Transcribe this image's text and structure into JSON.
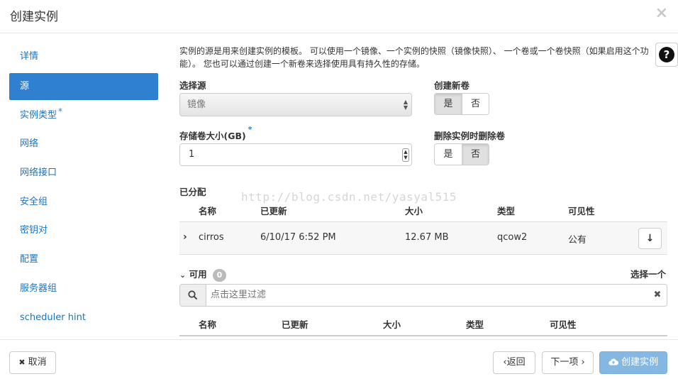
{
  "dialog": {
    "title": "创建实例",
    "close_icon": "×"
  },
  "sidebar": {
    "items": [
      {
        "label": "详情",
        "required": false
      },
      {
        "label": "源",
        "required": false
      },
      {
        "label": "实例类型",
        "required": true
      },
      {
        "label": "网络",
        "required": false
      },
      {
        "label": "网络接口",
        "required": false
      },
      {
        "label": "安全组",
        "required": false
      },
      {
        "label": "密钥对",
        "required": false
      },
      {
        "label": "配置",
        "required": false
      },
      {
        "label": "服务器组",
        "required": false
      },
      {
        "label": "scheduler hint",
        "required": false
      }
    ],
    "active_index": 1,
    "required_mark": "*"
  },
  "help": {
    "icon": "?"
  },
  "source": {
    "description": "实例的源是用来创建实例的模板。 可以使用一个镜像、一个实例的快照（镜像快照）、 一个卷或一个卷快照（如果启用这个功能）。 您也可以通过创建一个新卷来选择使用具有持久性的存储。",
    "select_source_label": "选择源",
    "select_source_value": "镜像",
    "create_volume_label": "创建新卷",
    "create_volume_yes": "是",
    "create_volume_no": "否",
    "create_volume_selected": "是",
    "volume_size_label": "存储卷大小(GB)",
    "volume_size_value": "1",
    "delete_volume_label": "删除实例时删除卷",
    "delete_volume_yes": "是",
    "delete_volume_no": "否",
    "delete_volume_selected": "否"
  },
  "allocated": {
    "title": "已分配",
    "columns": [
      "名称",
      "已更新",
      "大小",
      "类型",
      "可见性"
    ],
    "rows": [
      {
        "name": "cirros",
        "updated": "6/10/17 6:52 PM",
        "size": "12.67 MB",
        "type": "qcow2",
        "visibility": "公有"
      }
    ]
  },
  "available": {
    "title": "可用",
    "count": "0",
    "select_one": "选择一个",
    "filter_placeholder": "点击这里过滤",
    "columns": [
      "名称",
      "已更新",
      "大小",
      "类型",
      "可见性"
    ]
  },
  "watermark": "http://blog.csdn.net/yasyal515",
  "footer": {
    "cancel": "取消",
    "back": "返回",
    "next": "下一项",
    "create": "创建实例"
  },
  "colors": {
    "accent": "#2f80d1",
    "primary_disabled": "#84b8e3"
  }
}
